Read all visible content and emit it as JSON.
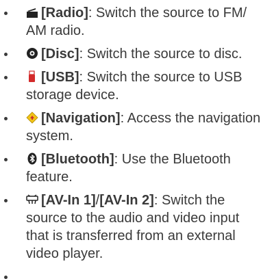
{
  "items": [
    {
      "icon": "radio-icon",
      "term": "[Radio]",
      "desc": ": Switch the source to FM/ AM radio."
    },
    {
      "icon": "disc-icon",
      "term": "[Disc]",
      "desc": ": Switch the source to disc."
    },
    {
      "icon": "usb-icon",
      "term": "[USB]",
      "desc": ": Switch the source to USB storage device."
    },
    {
      "icon": "navigation-icon",
      "term": "[Navigation]",
      "desc": ": Access the navigation system."
    },
    {
      "icon": "bluetooth-icon",
      "term": "[Bluetooth]",
      "desc": ": Use the Bluetooth feature."
    },
    {
      "icon": "av-in-icon",
      "term": "[AV-In 1]",
      "sep": "/",
      "term2": "[AV-In 2]",
      "desc": ": Switch the source to the audio and video input that is transferred from an external video player."
    },
    {
      "icon": "",
      "term": "",
      "desc": ""
    }
  ],
  "colors": {
    "text": "#3a3a3a",
    "usb_accent": "#d32a2a",
    "nav_yellow": "#f2c318",
    "nav_red": "#c8302a"
  }
}
